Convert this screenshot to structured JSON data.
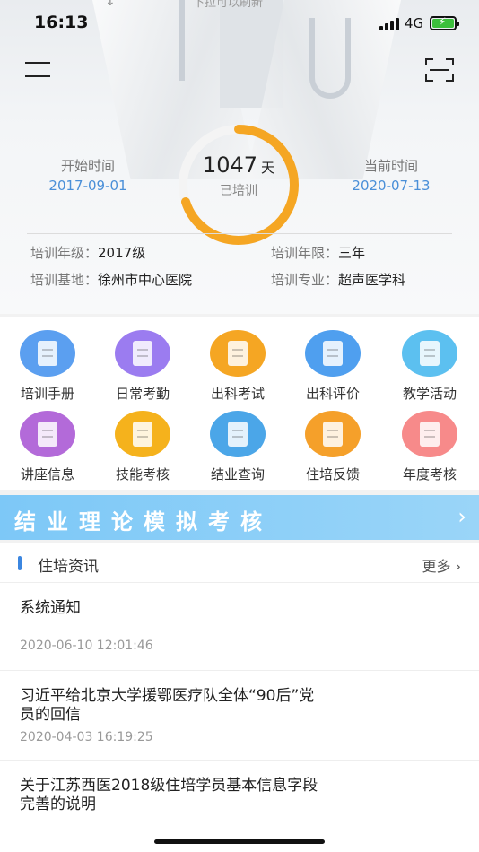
{
  "status": {
    "time": "16:13",
    "network": "4G",
    "pull_hint": "下拉可以刷新"
  },
  "training": {
    "start_label": "开始时间",
    "start_date": "2017-09-01",
    "current_label": "当前时间",
    "current_date": "2020-07-13",
    "days": "1047",
    "days_unit": "天",
    "days_sub": "已培训",
    "progress": 0.7,
    "ring_color": "#f5a623"
  },
  "info": {
    "grade_label": "培训年级：",
    "grade": "2017级",
    "years_label": "培训年限：",
    "years": "三年",
    "base_label": "培训基地：",
    "base": "徐州市中心医院",
    "major_label": "培训专业：",
    "major": "超声医学科"
  },
  "grid": [
    {
      "label": "培训手册",
      "color": "#5b9ff0",
      "icon": "book-icon"
    },
    {
      "label": "日常考勤",
      "color": "#9b7cf0",
      "icon": "clock-icon"
    },
    {
      "label": "出科考试",
      "color": "#f5a623",
      "icon": "exam-icon"
    },
    {
      "label": "出科评价",
      "color": "#4f9fef",
      "icon": "evaluation-icon"
    },
    {
      "label": "教学活动",
      "color": "#5cc0f0",
      "icon": "flag-icon"
    },
    {
      "label": "讲座信息",
      "color": "#b36ad9",
      "icon": "lecture-icon"
    },
    {
      "label": "技能考核",
      "color": "#f5b21c",
      "icon": "skill-icon"
    },
    {
      "label": "结业查询",
      "color": "#4ba6e8",
      "icon": "search-doc-icon"
    },
    {
      "label": "住培反馈",
      "color": "#f5a02a",
      "icon": "feedback-icon"
    },
    {
      "label": "年度考核",
      "color": "#f78a8a",
      "icon": "annual-icon"
    }
  ],
  "banner": {
    "text": "结业理论模拟考核",
    "arrow": "›"
  },
  "news": {
    "title": "住培资讯",
    "more": "更多 ›",
    "items": [
      {
        "title": "系统通知",
        "date": "2020-06-10 12:01:46"
      },
      {
        "title": "习近平给北京大学援鄂医疗队全体“90后”党员的回信",
        "date": "2020-04-03 16:19:25"
      },
      {
        "title": "关于江苏西医2018级住培学员基本信息字段完善的说明",
        "date": ""
      }
    ]
  }
}
